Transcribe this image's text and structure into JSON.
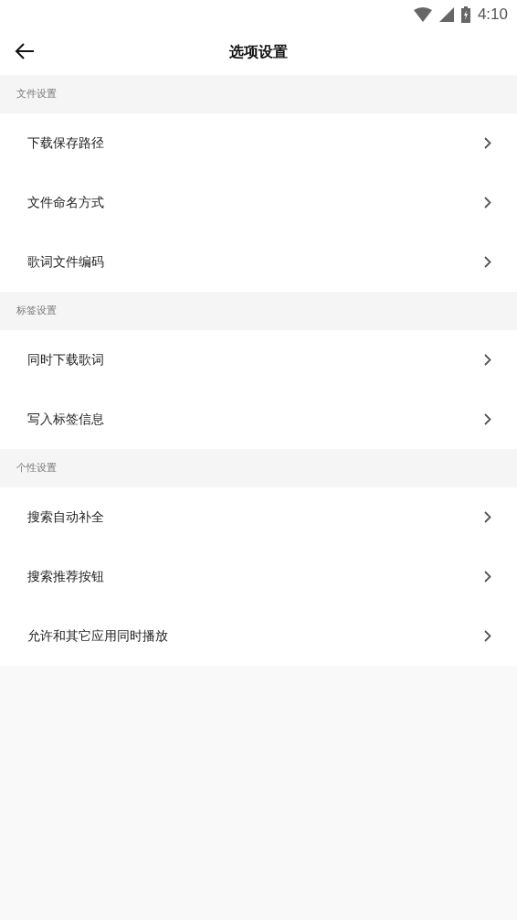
{
  "status_bar": {
    "time": "4:10"
  },
  "header": {
    "title": "选项设置"
  },
  "sections": [
    {
      "title": "文件设置",
      "items": [
        {
          "label": "下载保存路径"
        },
        {
          "label": "文件命名方式"
        },
        {
          "label": "歌词文件编码"
        }
      ]
    },
    {
      "title": "标签设置",
      "items": [
        {
          "label": "同时下载歌词"
        },
        {
          "label": "写入标签信息"
        }
      ]
    },
    {
      "title": "个性设置",
      "items": [
        {
          "label": "搜索自动补全"
        },
        {
          "label": "搜索推荐按钮"
        },
        {
          "label": "允许和其它应用同时播放"
        }
      ]
    }
  ]
}
